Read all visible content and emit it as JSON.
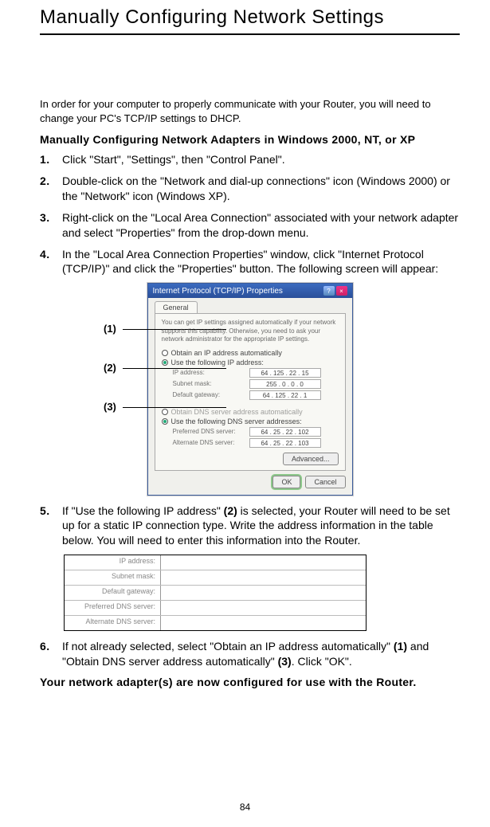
{
  "title": "Manually Configuring Network Settings",
  "intro": "In order for your computer to properly communicate with your Router, you will need to change your PC's TCP/IP settings to DHCP.",
  "subheading": "Manually Configuring Network Adapters in Windows 2000, NT, or XP",
  "steps": {
    "s1": {
      "num": "1.",
      "text": "Click \"Start\", \"Settings\", then \"Control Panel\"."
    },
    "s2": {
      "num": "2.",
      "text": "Double-click on the \"Network and dial-up connections\" icon (Windows 2000) or the \"Network\" icon (Windows XP)."
    },
    "s3": {
      "num": "3.",
      "text": "Right-click on the \"Local Area Connection\" associated with your network adapter and select \"Properties\" from the drop-down menu."
    },
    "s4": {
      "num": "4.",
      "text": "In the \"Local Area Connection Properties\" window, click \"Internet Protocol (TCP/IP)\" and click the \"Properties\" button. The following screen will appear:"
    },
    "s5": {
      "num": "5.",
      "pre": "If \"Use the following IP address\" ",
      "bold": "(2)",
      "post": " is selected, your Router will need to be set up for a static IP connection type. Write the address information in the table below. You will need to enter this information into the Router."
    },
    "s6": {
      "num": "6.",
      "pre": "If not already selected, select \"Obtain an IP address automatically\" ",
      "b1": "(1)",
      "mid": " and \"Obtain DNS server address automatically\" ",
      "b2": "(3)",
      "post": ". Click \"OK\"."
    }
  },
  "callouts": {
    "c1": "(1)",
    "c2": "(2)",
    "c3": "(3)"
  },
  "dialog": {
    "title": "Internet Protocol (TCP/IP) Properties",
    "tab": "General",
    "desc": "You can get IP settings assigned automatically if your network supports this capability. Otherwise, you need to ask your network administrator for the appropriate IP settings.",
    "r1": "Obtain an IP address automatically",
    "r2": "Use the following IP address:",
    "ip_label": "IP address:",
    "ip_value": "64 . 125 . 22 . 15",
    "subnet_label": "Subnet mask:",
    "subnet_value": "255 . 0 . 0 . 0",
    "gateway_label": "Default gateway:",
    "gateway_value": "64 . 125 . 22 . 1",
    "r3": "Obtain DNS server address automatically",
    "r4": "Use the following DNS server addresses:",
    "pdns_label": "Preferred DNS server:",
    "pdns_value": "64 . 25 . 22 . 102",
    "adns_label": "Alternate DNS server:",
    "adns_value": "64 . 25 . 22 . 103",
    "advanced": "Advanced...",
    "ok": "OK",
    "cancel": "Cancel"
  },
  "form": {
    "r1": "IP address:",
    "r2": "Subnet mask:",
    "r3": "Default gateway:",
    "r4": "Preferred DNS server:",
    "r5": "Alternate DNS server:"
  },
  "closing": "Your network adapter(s) are now configured for use with the Router.",
  "page_num": "84"
}
